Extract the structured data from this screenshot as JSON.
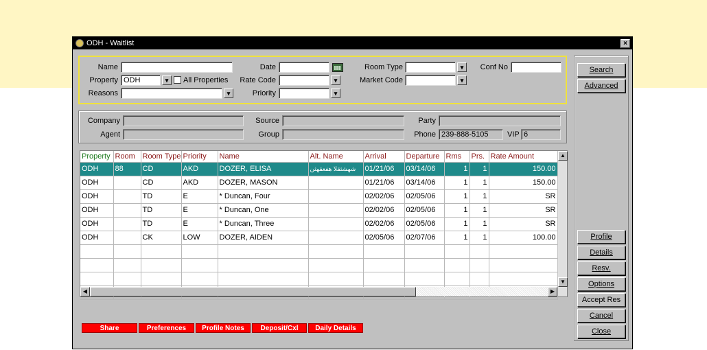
{
  "window": {
    "title": "ODH - Waitlist",
    "close_glyph": "×"
  },
  "search": {
    "name_label": "Name",
    "name_value": "",
    "property_label": "Property",
    "property_value": "ODH",
    "all_properties_label": "All Properties",
    "reasons_label": "Reasons",
    "reasons_value": "",
    "date_label": "Date",
    "date_value": "",
    "rate_code_label": "Rate Code",
    "rate_code_value": "",
    "priority_label": "Priority",
    "priority_value": "",
    "room_type_label": "Room Type",
    "room_type_value": "",
    "market_code_label": "Market Code",
    "market_code_value": "",
    "conf_no_label": "Conf No",
    "conf_no_value": ""
  },
  "details": {
    "company_label": "Company",
    "company_value": "",
    "agent_label": "Agent",
    "agent_value": "",
    "source_label": "Source",
    "source_value": "",
    "group_label": "Group",
    "group_value": "",
    "party_label": "Party",
    "party_value": "",
    "phone_label": "Phone",
    "phone_value": "239-888-5105",
    "vip_label": "VIP",
    "vip_value": "6"
  },
  "buttons": {
    "search": "Search",
    "advanced": "Advanced",
    "profile": "Profile",
    "details": "Details",
    "resv": "Resv.",
    "options": "Options",
    "accept_res": "Accept Res",
    "cancel": "Cancel",
    "close": "Close"
  },
  "grid": {
    "columns": [
      "Property",
      "Room",
      "Room Type",
      "Priority",
      "Name",
      "Alt. Name",
      "Arrival",
      "Departure",
      "Rms",
      "Prs.",
      "Rate Amount"
    ],
    "rows": [
      [
        "ODH",
        "88",
        "CD",
        "AKD",
        "DOZER, ELISA",
        "شهشثقلا هفعقهثن",
        "01/21/06",
        "03/14/06",
        "1",
        "1",
        "150.00"
      ],
      [
        "ODH",
        "",
        "CD",
        "AKD",
        "DOZER, MASON",
        "",
        "01/21/06",
        "03/14/06",
        "1",
        "1",
        "150.00"
      ],
      [
        "ODH",
        "",
        "TD",
        "E",
        "* Duncan, Four",
        "",
        "02/02/06",
        "02/05/06",
        "1",
        "1",
        "SR"
      ],
      [
        "ODH",
        "",
        "TD",
        "E",
        "* Duncan, One",
        "",
        "02/02/06",
        "02/05/06",
        "1",
        "1",
        "SR"
      ],
      [
        "ODH",
        "",
        "TD",
        "E",
        "* Duncan, Three",
        "",
        "02/02/06",
        "02/05/06",
        "1",
        "1",
        "SR"
      ],
      [
        "ODH",
        "",
        "CK",
        "LOW",
        "DOZER, AIDEN",
        "",
        "02/05/06",
        "02/07/06",
        "1",
        "1",
        "100.00"
      ]
    ],
    "selected_row": 0
  },
  "bottom_tabs": [
    "Share",
    "Preferences",
    "Profile Notes",
    "Deposit/Cxl",
    "Daily Details"
  ],
  "colors": {
    "selection": "#1f8a8a",
    "highlight_border": "#f0e23c",
    "red_button": "#ff0000",
    "header_text": "#8b1a1a"
  }
}
